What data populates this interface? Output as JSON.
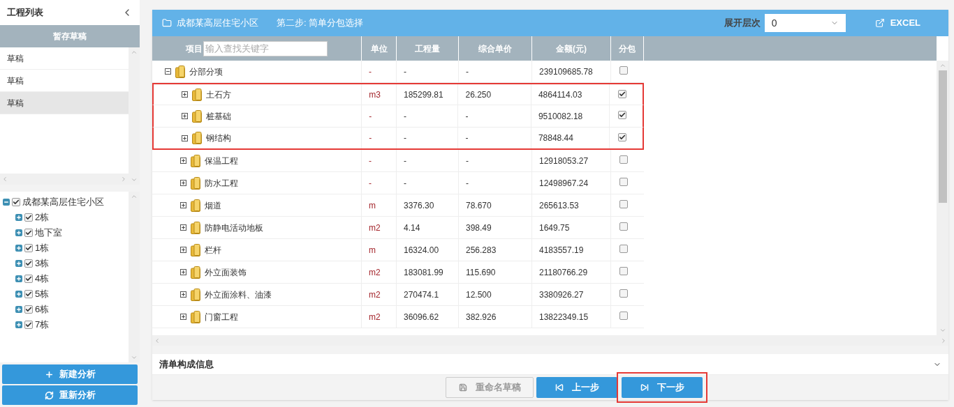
{
  "sidebar": {
    "title": "工程列表",
    "drafts_header": "暂存草稿",
    "drafts": [
      {
        "label": "草稿",
        "selected": false
      },
      {
        "label": "草稿",
        "selected": false
      },
      {
        "label": "草稿",
        "selected": true
      }
    ],
    "tree": {
      "label": "成都某高层住宅小区",
      "checked": true,
      "expanded": true,
      "children": [
        {
          "label": "2栋",
          "checked": true,
          "expanded": false
        },
        {
          "label": "地下室",
          "checked": true,
          "expanded": false
        },
        {
          "label": "1栋",
          "checked": true,
          "expanded": false
        },
        {
          "label": "3栋",
          "checked": true,
          "expanded": false
        },
        {
          "label": "4栋",
          "checked": true,
          "expanded": false
        },
        {
          "label": "5栋",
          "checked": true,
          "expanded": false
        },
        {
          "label": "6栋",
          "checked": true,
          "expanded": false
        },
        {
          "label": "7栋",
          "checked": true,
          "expanded": false
        }
      ]
    },
    "buttons": [
      {
        "label": "新建分析",
        "kind": "new"
      },
      {
        "label": "重新分析",
        "kind": "redo"
      }
    ]
  },
  "main": {
    "title": "成都某高层住宅小区",
    "step": "第二步: 简单分包选择",
    "level_label": "展开层次",
    "level_value": "0",
    "export": "EXCEL",
    "search_label": "项目",
    "search": {
      "placeholder": "输入查找关键字"
    },
    "columns": [
      "单位",
      "工程量",
      "综合单价",
      "金额(元)",
      "分包"
    ],
    "rows": [
      {
        "name": "分部分项",
        "expanded": true,
        "unit": "-",
        "qty": "-",
        "price": "-",
        "amount": "239109685.78",
        "checked": false,
        "highlighted": false,
        "children": [
          {
            "name": "土石方",
            "expanded": false,
            "unit": "m3",
            "qty": "185299.81",
            "price": "26.250",
            "amount": "4864114.03",
            "checked": true,
            "highlighted": true
          },
          {
            "name": "桩基础",
            "expanded": false,
            "unit": "-",
            "qty": "-",
            "price": "-",
            "amount": "9510082.18",
            "checked": true,
            "highlighted": true
          },
          {
            "name": "钢结构",
            "expanded": false,
            "unit": "-",
            "qty": "-",
            "price": "-",
            "amount": "78848.44",
            "checked": true,
            "highlighted": true
          },
          {
            "name": "保温工程",
            "expanded": false,
            "unit": "-",
            "qty": "-",
            "price": "-",
            "amount": "12918053.27",
            "checked": false,
            "highlighted": false
          },
          {
            "name": "防水工程",
            "expanded": false,
            "unit": "-",
            "qty": "-",
            "price": "-",
            "amount": "12498967.24",
            "checked": false,
            "highlighted": false
          },
          {
            "name": "烟道",
            "expanded": false,
            "unit": "m",
            "qty": "3376.30",
            "price": "78.670",
            "amount": "265613.53",
            "checked": false,
            "highlighted": false
          },
          {
            "name": "防静电活动地板",
            "expanded": false,
            "unit": "m2",
            "qty": "4.14",
            "price": "398.49",
            "amount": "1649.75",
            "checked": false,
            "highlighted": false
          },
          {
            "name": "栏杆",
            "expanded": false,
            "unit": "m",
            "qty": "16324.00",
            "price": "256.283",
            "amount": "4183557.19",
            "checked": false,
            "highlighted": false
          },
          {
            "name": "外立面装饰",
            "expanded": false,
            "unit": "m2",
            "qty": "183081.99",
            "price": "115.690",
            "amount": "21180766.29",
            "checked": false,
            "highlighted": false
          },
          {
            "name": "外立面涂料、油漆",
            "expanded": false,
            "unit": "m2",
            "qty": "270474.1",
            "price": "12.500",
            "amount": "3380926.27",
            "checked": false,
            "highlighted": false
          },
          {
            "name": "门窗工程",
            "expanded": false,
            "unit": "m2",
            "qty": "36096.62",
            "price": "382.926",
            "amount": "13822349.15",
            "checked": false,
            "highlighted": false
          }
        ]
      }
    ],
    "detail_title": "清单构成信息",
    "buttons": [
      {
        "label": "重命名草稿",
        "kind": "rename",
        "disabled": true,
        "highlighted": false
      },
      {
        "label": "上一步",
        "kind": "prev",
        "disabled": false,
        "highlighted": false
      },
      {
        "label": "下一步",
        "kind": "next",
        "disabled": false,
        "highlighted": true
      }
    ]
  }
}
